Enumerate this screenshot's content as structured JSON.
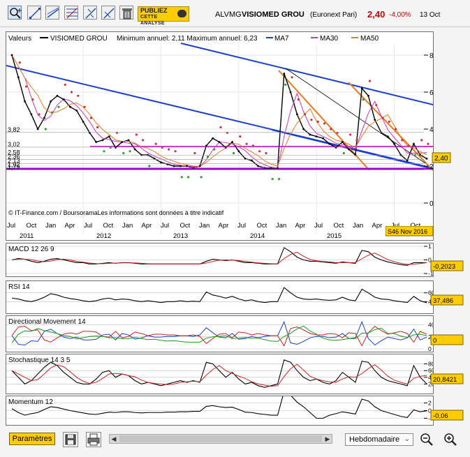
{
  "header": {
    "ticker": "ALVMG",
    "name": "VISIOMED GROU",
    "market": "(Euronext Pari)",
    "price": "2,40",
    "change": "-4,00%",
    "date": "13 Oct"
  },
  "ad": {
    "line1": "PUBLIEZ",
    "line2": "CETTE",
    "line3": "ANALYSE"
  },
  "toolbar": {
    "icons": [
      "zoom-in-icon",
      "line-icon",
      "trendline-icon",
      "fibonacci-icon",
      "crosshair-icon",
      "ray-icon",
      "trash-icon"
    ]
  },
  "main": {
    "legend": {
      "valeurs": "Valeurs",
      "series_name": "VISIOMED GROU",
      "minmax": "Minimum annuel: 2,11 Maximum annuel: 6,23",
      "ma7": "MA7",
      "ma30": "MA30",
      "ma50": "MA50"
    },
    "left_labels": [
      "3,82",
      "3,02",
      "2,58",
      "2,36",
      "2,13",
      "1,92",
      "1,79"
    ],
    "right_ticks": [
      "8",
      "6",
      "4",
      "2",
      "0"
    ],
    "last_price": "2,40",
    "credit": "© IT-Finance.com / BoursoramaLes informations sont données à titre indicatif",
    "week_badge": "S46 Nov 2016",
    "month_labels": [
      "Jul",
      "Oct",
      "Jan",
      "Apr",
      "Jul",
      "Oct",
      "Jan",
      "Apr",
      "Jul",
      "Oct",
      "Jan",
      "Apr",
      "Jul",
      "Oct",
      "Jan",
      "Apr",
      "Jul",
      "Oct",
      "Jan",
      "Apr",
      "Jul",
      "Oct"
    ],
    "year_labels": [
      "2011",
      "2012",
      "2013",
      "2014",
      "2015"
    ]
  },
  "indicators": {
    "macd": {
      "title": "MACD 12 26 9",
      "ticks": [
        "1",
        "0",
        "-1"
      ],
      "value": "-0,2023"
    },
    "rsi": {
      "title": "RSI 14",
      "ticks": [
        "60",
        "40"
      ],
      "value": "37,486"
    },
    "dm": {
      "title": "Directional Movement 14",
      "ticks": [
        "40",
        "20",
        "0"
      ],
      "value": "0"
    },
    "stoch": {
      "title": "Stochastique 14 3 5",
      "ticks": [
        "80",
        "60",
        "40",
        "20"
      ],
      "value": "20,8421"
    },
    "momentum": {
      "title": "Momentum 12",
      "ticks": [
        "2",
        "0",
        "-2"
      ],
      "value": "-0,06"
    }
  },
  "bottombar": {
    "params": "Paramètres",
    "period": "Hebdomadaire"
  },
  "chart_data": {
    "type": "line",
    "title": "VISIOMED GROU",
    "x_range": [
      "2011-07",
      "2016-11"
    ],
    "ylim": [
      -0.5,
      9
    ],
    "series": [
      {
        "name": "VISIOMED GROU",
        "x": [
          "2011-07",
          "2011-08",
          "2011-09",
          "2011-10",
          "2011-11",
          "2011-12",
          "2012-01",
          "2012-02",
          "2012-03",
          "2012-04",
          "2012-05",
          "2012-06",
          "2012-07",
          "2012-08",
          "2012-09",
          "2012-10",
          "2012-11",
          "2012-12",
          "2013-01",
          "2013-02",
          "2013-03",
          "2013-04",
          "2013-05",
          "2013-06",
          "2013-07",
          "2013-08",
          "2013-09",
          "2013-10",
          "2013-11",
          "2013-12",
          "2014-01",
          "2014-02",
          "2014-03",
          "2014-04",
          "2014-05",
          "2014-06",
          "2014-07",
          "2014-08",
          "2014-09",
          "2014-10",
          "2014-11",
          "2014-12",
          "2015-01",
          "2015-02",
          "2015-03",
          "2015-04",
          "2015-05",
          "2015-06",
          "2015-07",
          "2015-08",
          "2015-09",
          "2015-10",
          "2015-11",
          "2015-12",
          "2016-01",
          "2016-02",
          "2016-03",
          "2016-04",
          "2016-05",
          "2016-06",
          "2016-07",
          "2016-08",
          "2016-09",
          "2016-10",
          "2016-11"
        ],
        "values": [
          8.0,
          6.8,
          5.5,
          4.8,
          4.0,
          4.6,
          5.5,
          5.8,
          5.6,
          5.2,
          5.0,
          4.4,
          3.8,
          3.3,
          3.4,
          3.6,
          3.0,
          3.3,
          3.4,
          2.9,
          2.6,
          2.6,
          2.4,
          2.2,
          2.1,
          2.0,
          2.0,
          2.0,
          1.9,
          2.0,
          3.1,
          3.5,
          3.3,
          3.0,
          3.3,
          2.8,
          2.4,
          2.3,
          2.0,
          1.9,
          1.9,
          1.9,
          7.0,
          6.0,
          4.8,
          4.0,
          3.7,
          3.6,
          3.5,
          3.2,
          3.0,
          3.3,
          2.9,
          2.6,
          6.2,
          5.8,
          4.5,
          3.8,
          3.6,
          3.2,
          2.6,
          2.3,
          3.2,
          2.6,
          2.4
        ]
      },
      {
        "name": "MACD 12 26 9",
        "values": [
          0.0,
          0.1,
          0.05,
          -0.1,
          -0.2,
          -0.1,
          0.05,
          0.1,
          0.0,
          -0.1,
          -0.2,
          -0.2,
          -0.3,
          -0.3,
          -0.25,
          -0.2,
          -0.25,
          -0.2,
          -0.2,
          -0.25,
          -0.3,
          -0.3,
          -0.3,
          -0.3,
          -0.3,
          -0.3,
          -0.3,
          -0.3,
          -0.3,
          -0.3,
          -0.1,
          0.05,
          0.0,
          -0.05,
          0.0,
          -0.1,
          -0.2,
          -0.2,
          -0.25,
          -0.3,
          -0.3,
          -0.3,
          0.9,
          0.6,
          0.2,
          0.0,
          -0.1,
          -0.1,
          -0.15,
          -0.2,
          -0.25,
          -0.15,
          -0.2,
          -0.25,
          0.7,
          0.6,
          0.2,
          0.0,
          -0.15,
          -0.25,
          -0.35,
          -0.4,
          -0.2,
          -0.2,
          -0.2023
        ]
      },
      {
        "name": "RSI 14",
        "values": [
          48,
          46,
          42,
          40,
          44,
          50,
          58,
          55,
          50,
          47,
          45,
          42,
          40,
          42,
          46,
          48,
          44,
          46,
          45,
          42,
          40,
          42,
          40,
          38,
          40,
          40,
          42,
          40,
          41,
          40,
          62,
          55,
          52,
          48,
          52,
          46,
          42,
          44,
          40,
          38,
          40,
          40,
          72,
          60,
          50,
          46,
          45,
          46,
          44,
          43,
          44,
          50,
          44,
          42,
          68,
          60,
          50,
          46,
          45,
          42,
          40,
          38,
          52,
          42,
          37.486
        ]
      },
      {
        "name": "Stochastique 14 3 5",
        "values": [
          60,
          40,
          20,
          30,
          50,
          70,
          85,
          75,
          55,
          40,
          25,
          20,
          20,
          35,
          55,
          60,
          40,
          50,
          45,
          30,
          20,
          25,
          20,
          15,
          20,
          25,
          30,
          25,
          30,
          25,
          85,
          80,
          60,
          40,
          55,
          35,
          20,
          25,
          15,
          10,
          15,
          20,
          92,
          85,
          60,
          40,
          30,
          35,
          25,
          20,
          30,
          55,
          40,
          25,
          88,
          85,
          60,
          40,
          30,
          25,
          20,
          15,
          75,
          40,
          20.8421
        ]
      },
      {
        "name": "Momentum 12",
        "values": [
          0.5,
          -0.5,
          -1.2,
          -0.8,
          -0.5,
          0.3,
          1.0,
          0.8,
          0.4,
          0.0,
          -0.3,
          -0.6,
          -0.9,
          -1.0,
          -0.7,
          -0.4,
          -0.5,
          -0.3,
          -0.3,
          -0.5,
          -0.6,
          -0.5,
          -0.5,
          -0.5,
          -0.4,
          -0.4,
          -0.3,
          -0.3,
          -0.2,
          -0.2,
          1.1,
          1.3,
          1.0,
          0.8,
          0.9,
          0.3,
          -0.4,
          -0.5,
          -0.8,
          -1.0,
          -1.2,
          -1.2,
          5.0,
          4.0,
          2.2,
          1.0,
          -0.5,
          -2.0,
          -2.0,
          -1.2,
          -0.8,
          -0.3,
          -0.6,
          -0.9,
          3.0,
          2.5,
          1.0,
          0.0,
          -0.5,
          -1.0,
          -1.5,
          -1.8,
          0.2,
          -0.3,
          -0.06
        ]
      }
    ]
  }
}
